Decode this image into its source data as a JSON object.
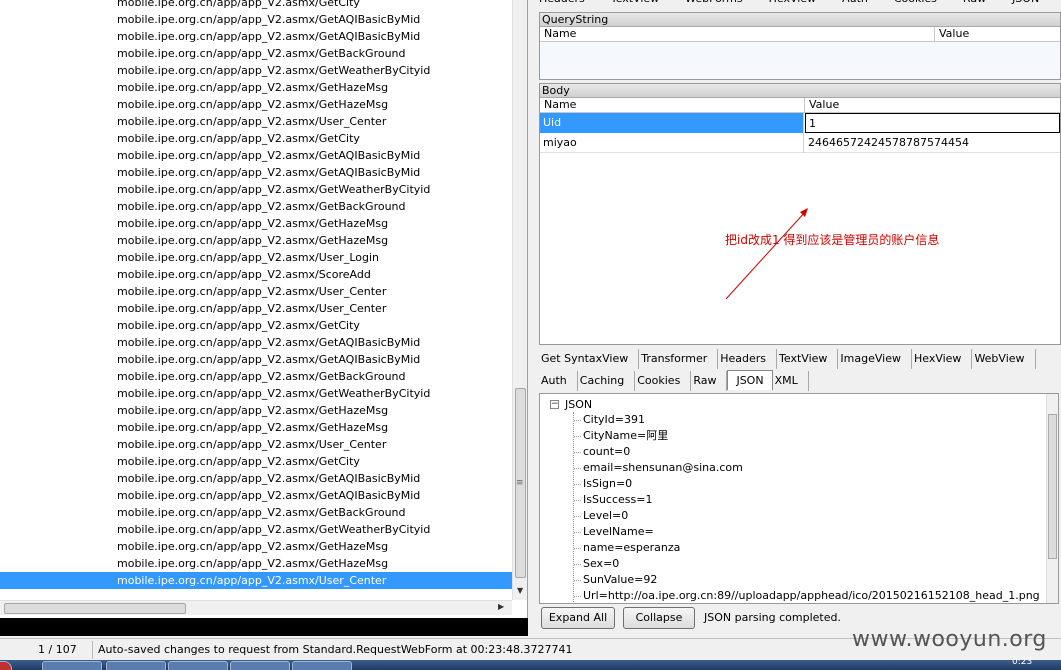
{
  "sessions": [
    {
      "host": "mobile.ipe.org.cn",
      "url": "/app/app_V2.asmx/GetCity"
    },
    {
      "host": "mobile.ipe.org.cn",
      "url": "/app/app_V2.asmx/GetAQIBasicByMid"
    },
    {
      "host": "mobile.ipe.org.cn",
      "url": "/app/app_V2.asmx/GetAQIBasicByMid"
    },
    {
      "host": "mobile.ipe.org.cn",
      "url": "/app/app_V2.asmx/GetBackGround"
    },
    {
      "host": "mobile.ipe.org.cn",
      "url": "/app/app_V2.asmx/GetWeatherByCityid"
    },
    {
      "host": "mobile.ipe.org.cn",
      "url": "/app/app_V2.asmx/GetHazeMsg"
    },
    {
      "host": "mobile.ipe.org.cn",
      "url": "/app/app_V2.asmx/GetHazeMsg"
    },
    {
      "host": "mobile.ipe.org.cn",
      "url": "/app/app_V2.asmx/User_Center"
    },
    {
      "host": "mobile.ipe.org.cn",
      "url": "/app/app_V2.asmx/GetCity"
    },
    {
      "host": "mobile.ipe.org.cn",
      "url": "/app/app_V2.asmx/GetAQIBasicByMid"
    },
    {
      "host": "mobile.ipe.org.cn",
      "url": "/app/app_V2.asmx/GetAQIBasicByMid"
    },
    {
      "host": "mobile.ipe.org.cn",
      "url": "/app/app_V2.asmx/GetWeatherByCityid"
    },
    {
      "host": "mobile.ipe.org.cn",
      "url": "/app/app_V2.asmx/GetBackGround"
    },
    {
      "host": "mobile.ipe.org.cn",
      "url": "/app/app_V2.asmx/GetHazeMsg"
    },
    {
      "host": "mobile.ipe.org.cn",
      "url": "/app/app_V2.asmx/GetHazeMsg"
    },
    {
      "host": "mobile.ipe.org.cn",
      "url": "/app/app_V2.asmx/User_Login"
    },
    {
      "host": "mobile.ipe.org.cn",
      "url": "/app/app_V2.asmx/ScoreAdd"
    },
    {
      "host": "mobile.ipe.org.cn",
      "url": "/app/app_V2.asmx/User_Center"
    },
    {
      "host": "mobile.ipe.org.cn",
      "url": "/app/app_V2.asmx/User_Center"
    },
    {
      "host": "mobile.ipe.org.cn",
      "url": "/app/app_V2.asmx/GetCity"
    },
    {
      "host": "mobile.ipe.org.cn",
      "url": "/app/app_V2.asmx/GetAQIBasicByMid"
    },
    {
      "host": "mobile.ipe.org.cn",
      "url": "/app/app_V2.asmx/GetAQIBasicByMid"
    },
    {
      "host": "mobile.ipe.org.cn",
      "url": "/app/app_V2.asmx/GetBackGround"
    },
    {
      "host": "mobile.ipe.org.cn",
      "url": "/app/app_V2.asmx/GetWeatherByCityid"
    },
    {
      "host": "mobile.ipe.org.cn",
      "url": "/app/app_V2.asmx/GetHazeMsg"
    },
    {
      "host": "mobile.ipe.org.cn",
      "url": "/app/app_V2.asmx/GetHazeMsg"
    },
    {
      "host": "mobile.ipe.org.cn",
      "url": "/app/app_V2.asmx/User_Center"
    },
    {
      "host": "mobile.ipe.org.cn",
      "url": "/app/app_V2.asmx/GetCity"
    },
    {
      "host": "mobile.ipe.org.cn",
      "url": "/app/app_V2.asmx/GetAQIBasicByMid"
    },
    {
      "host": "mobile.ipe.org.cn",
      "url": "/app/app_V2.asmx/GetAQIBasicByMid"
    },
    {
      "host": "mobile.ipe.org.cn",
      "url": "/app/app_V2.asmx/GetBackGround"
    },
    {
      "host": "mobile.ipe.org.cn",
      "url": "/app/app_V2.asmx/GetWeatherByCityid"
    },
    {
      "host": "mobile.ipe.org.cn",
      "url": "/app/app_V2.asmx/GetHazeMsg"
    },
    {
      "host": "mobile.ipe.org.cn",
      "url": "/app/app_V2.asmx/GetHazeMsg"
    },
    {
      "host": "mobile.ipe.org.cn",
      "url": "/app/app_V2.asmx/User_Center",
      "selected": true
    }
  ],
  "inspector": {
    "top_tabs": [
      "Headers",
      "TextView",
      "WebForms",
      "HexView",
      "Auth",
      "Cookies",
      "Raw",
      "JSON",
      "XML"
    ],
    "querystring": {
      "title": "QueryString",
      "col_name": "Name",
      "col_value": "Value"
    },
    "body": {
      "title": "Body",
      "col_name": "Name",
      "col_value": "Value",
      "rows": [
        {
          "name": "Uid",
          "value": "1"
        },
        {
          "name": "miyao",
          "value": "24646572424578787574454"
        }
      ]
    },
    "annotation": "把id改成1 得到应该是管理员的账户信息",
    "annotation_color": "#d10000"
  },
  "response": {
    "tabs_row1": [
      "Get SyntaxView",
      "Transformer",
      "Headers",
      "TextView",
      "ImageView",
      "HexView",
      "WebView"
    ],
    "tabs_row2": [
      "Auth",
      "Caching",
      "Cookies",
      "Raw",
      "JSON",
      "XML"
    ],
    "active_tab": "JSON",
    "tree_root": "JSON",
    "tree_nodes": [
      "CityId=391",
      "CityName=阿里",
      "count=0",
      "email=shensunan@sina.com",
      "IsSign=0",
      "IsSuccess=1",
      "Level=0",
      "LevelName=",
      "name=esperanza",
      "Sex=0",
      "SunValue=92",
      "Url=http://oa.ipe.org.cn:89//uploadapp/apphead/ico/20150216152108_head_1.png"
    ],
    "expand_all_label": "Expand All",
    "collapse_label": "Collapse",
    "parse_status": "JSON parsing completed."
  },
  "statusbar": {
    "count": "1 / 107",
    "message": "Auto-saved changes to request from Standard.RequestWebForm at 00:23:48.3727741"
  },
  "watermark": "www.wooyun.org",
  "clock": "0:23",
  "colors": {
    "selection": "#3399ff",
    "annotation": "#d10000"
  }
}
